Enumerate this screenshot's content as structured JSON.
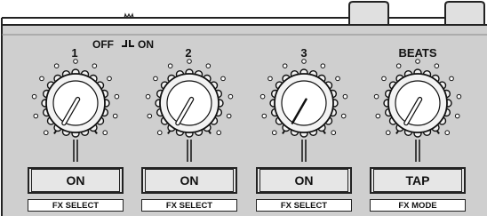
{
  "switch": {
    "off": "OFF",
    "on": "ON"
  },
  "knobs": [
    {
      "label": "1",
      "button": "ON",
      "caption": "FX SELECT",
      "pointer": "white"
    },
    {
      "label": "2",
      "button": "ON",
      "caption": "FX SELECT",
      "pointer": "white"
    },
    {
      "label": "3",
      "button": "ON",
      "caption": "FX SELECT",
      "pointer": "black"
    },
    {
      "label": "BEATS",
      "button": "TAP",
      "caption": "FX MODE",
      "pointer": "white"
    }
  ],
  "colors": {
    "panel": "#cfcfcf",
    "line": "#222222",
    "button": "#e6e6e6"
  }
}
